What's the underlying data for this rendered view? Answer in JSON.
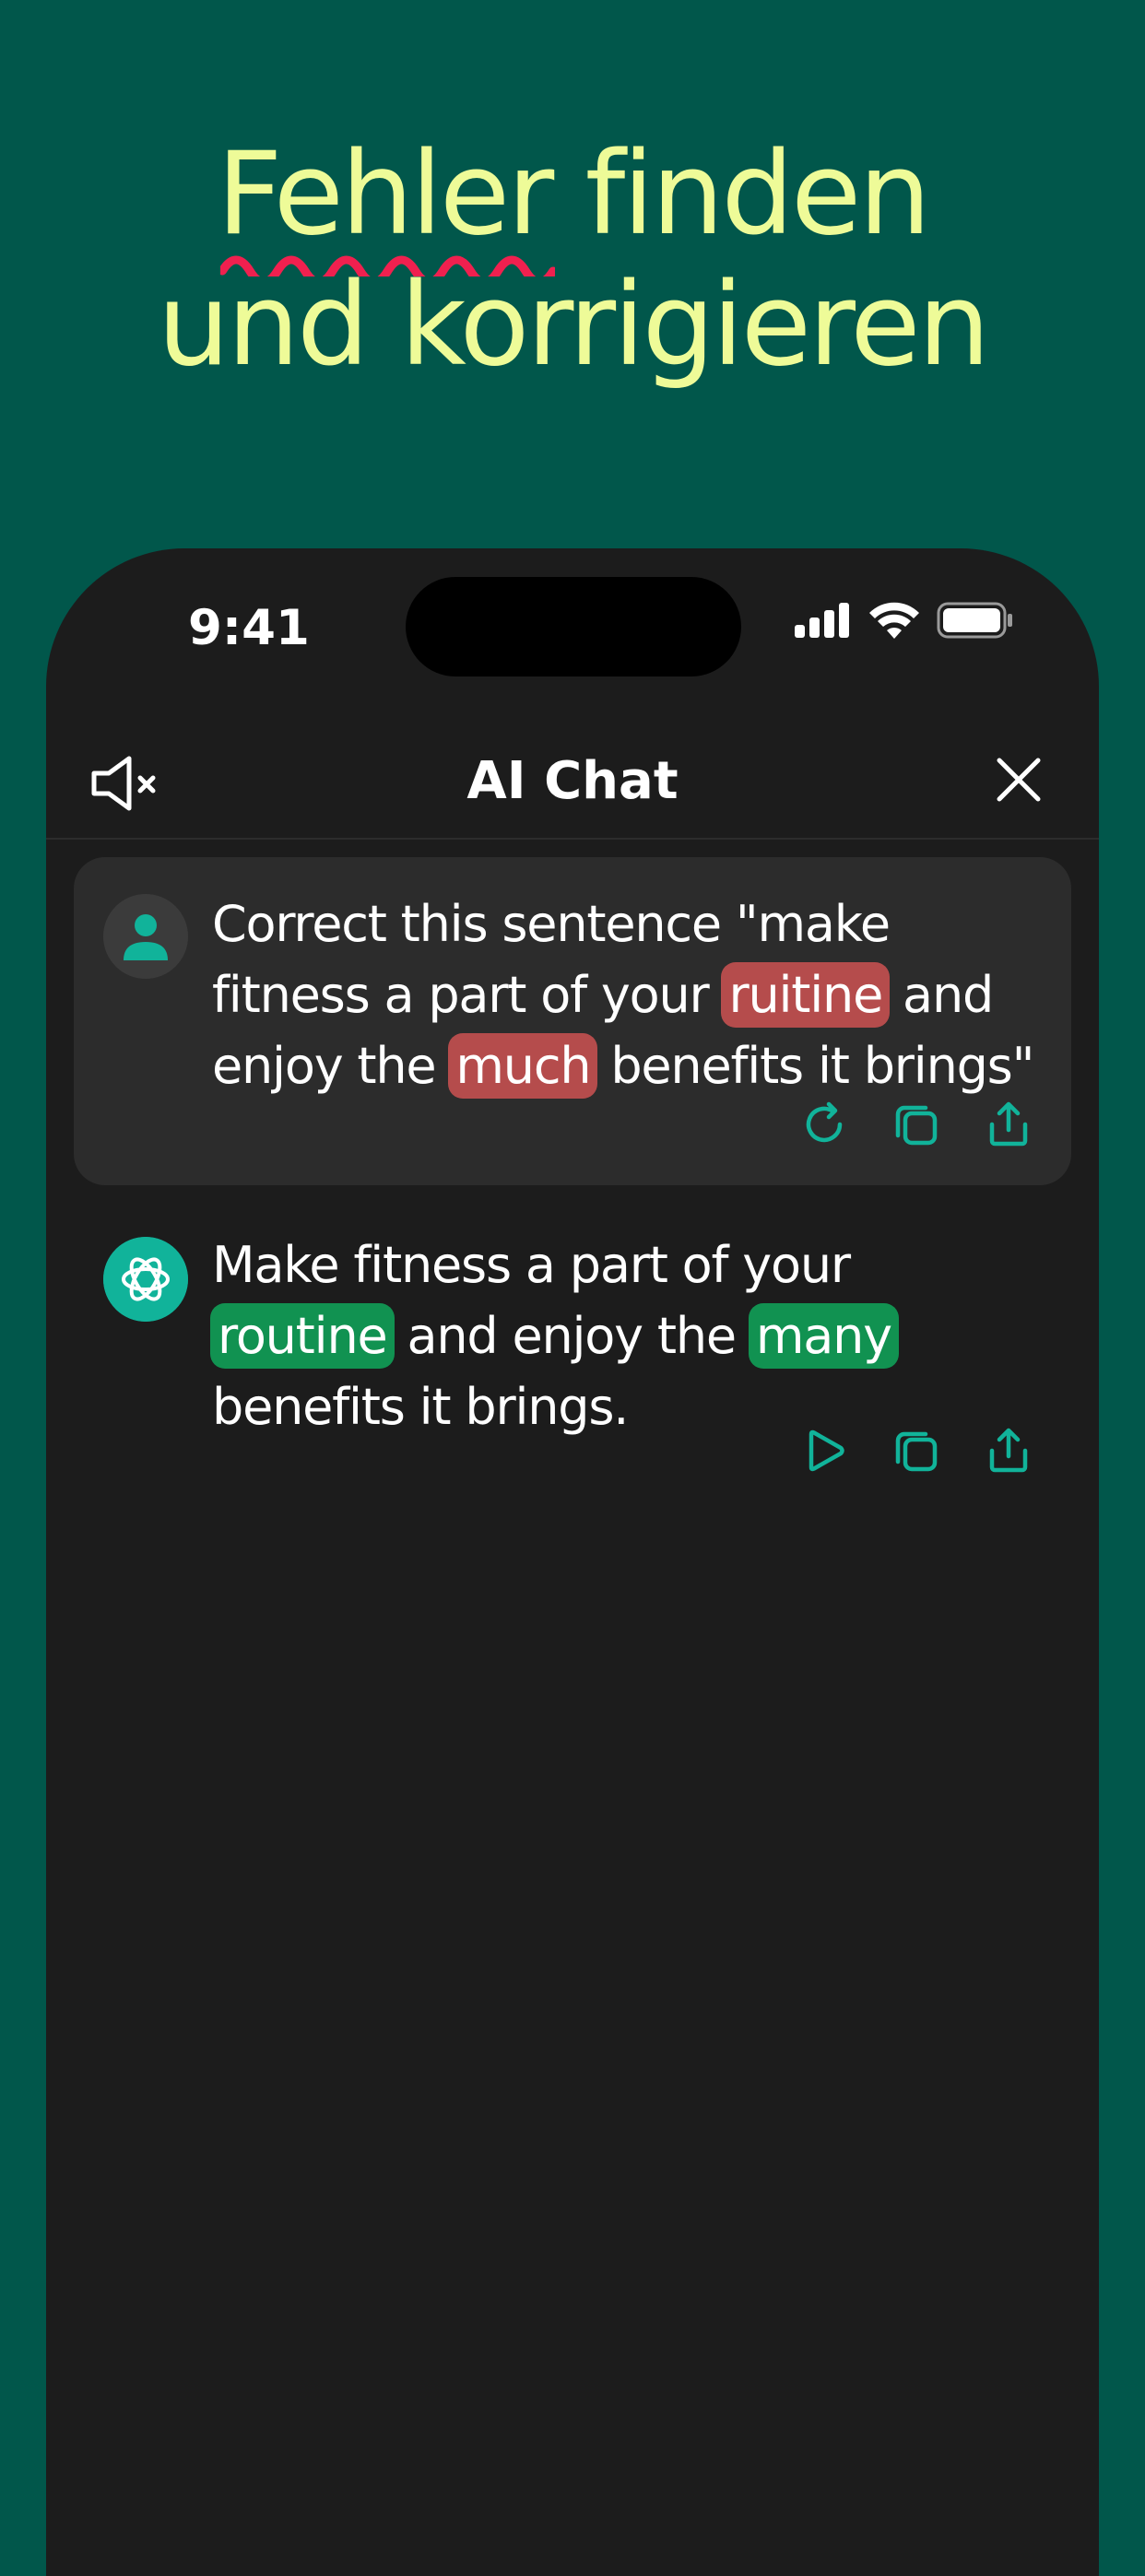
{
  "headline": {
    "line1_error": "Fehler",
    "line1_rest": " finden",
    "line2": "und korrigieren"
  },
  "colors": {
    "background": "#01574b",
    "headline": "#eefb98",
    "squiggle": "#f0204f",
    "accent": "#11b39a",
    "error_highlight": "#b54c4c",
    "correct_highlight": "#119251"
  },
  "status_bar": {
    "time": "9:41"
  },
  "nav": {
    "title": "AI Chat",
    "left_icon": "speaker-muted-icon",
    "right_icon": "close-icon"
  },
  "user_message": {
    "text_before_1": "Correct this sentence \"make fitness a part of your ",
    "error_1": "ruitine",
    "text_between": " and enjoy the ",
    "error_2": "much",
    "text_after": " benefits it brings\"",
    "actions": [
      "refresh-icon",
      "copy-icon",
      "share-icon"
    ]
  },
  "ai_message": {
    "text_before_1": "Make fitness a part of your ",
    "fix_1": "routine",
    "text_between": " and enjoy the ",
    "fix_2": "many",
    "text_after": " benefits it brings.",
    "actions": [
      "play-icon",
      "copy-icon",
      "share-icon"
    ]
  }
}
